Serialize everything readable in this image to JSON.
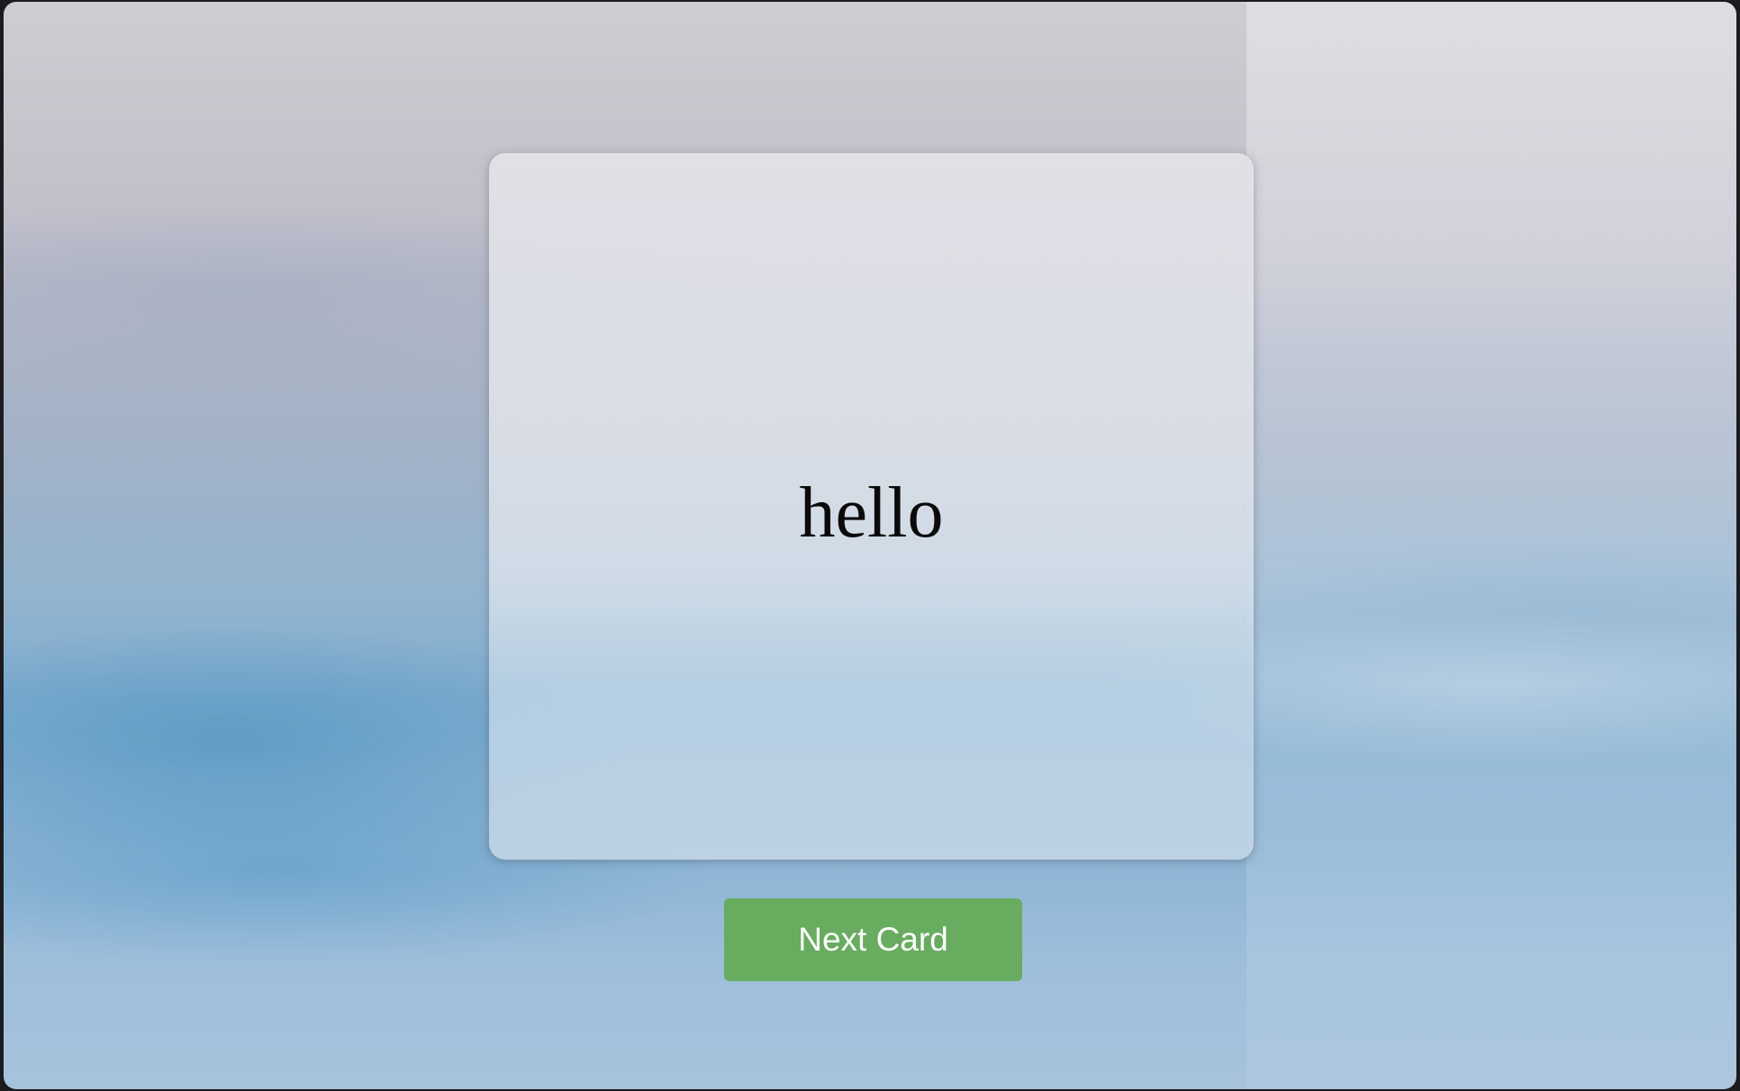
{
  "card": {
    "word": "hello"
  },
  "controls": {
    "next_label": "Next Card"
  },
  "colors": {
    "button_bg": "#67ac5f",
    "button_text": "#ffffff",
    "card_text": "#0a0a0a"
  }
}
